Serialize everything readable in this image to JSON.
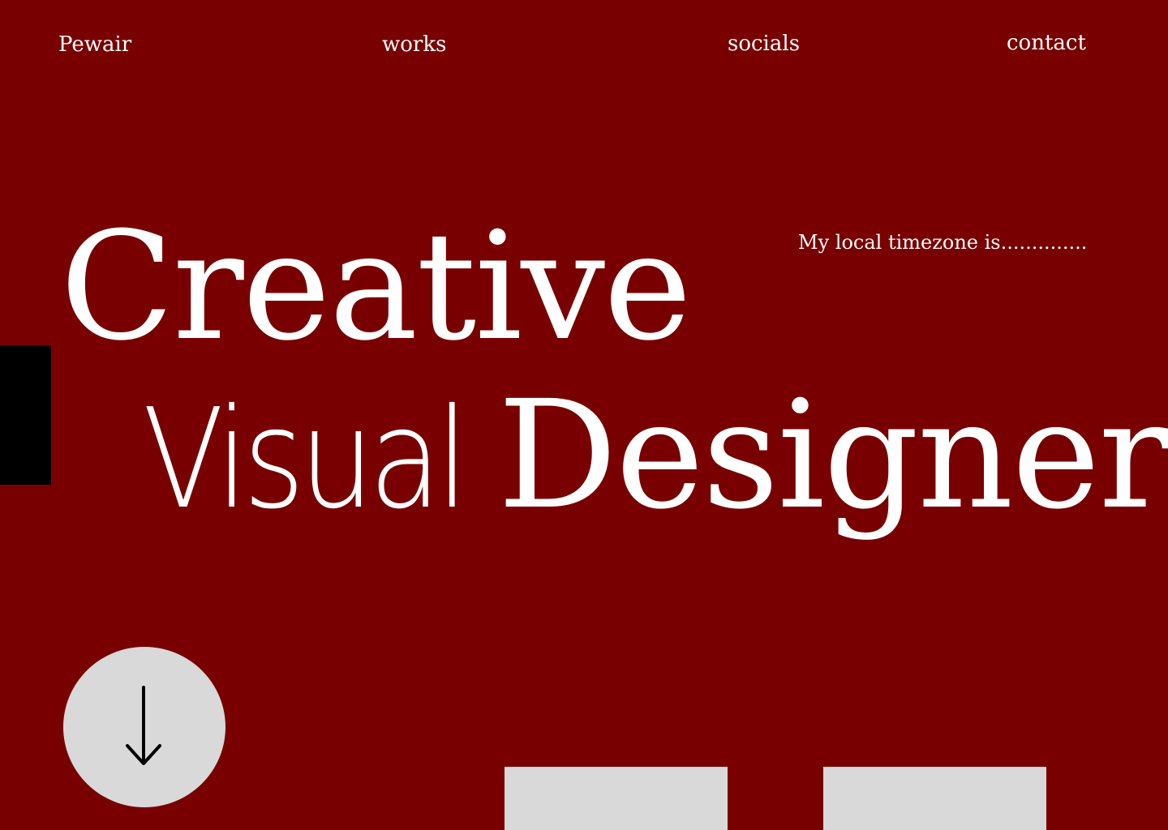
{
  "nav": {
    "brand": "Pewair",
    "links": [
      "works",
      "socials",
      "contact"
    ]
  },
  "timezone_text": "My local timezone is..............",
  "hero": {
    "line1": "Creative",
    "line2_word1": "Visual",
    "line2_word2": "Designer"
  },
  "scroll_icon": "arrow-down-icon",
  "colors": {
    "background": "#780000",
    "text": "#ffffff",
    "accent_bar": "#000000",
    "button": "#d9d9d9",
    "card": "#d9d9d9"
  }
}
